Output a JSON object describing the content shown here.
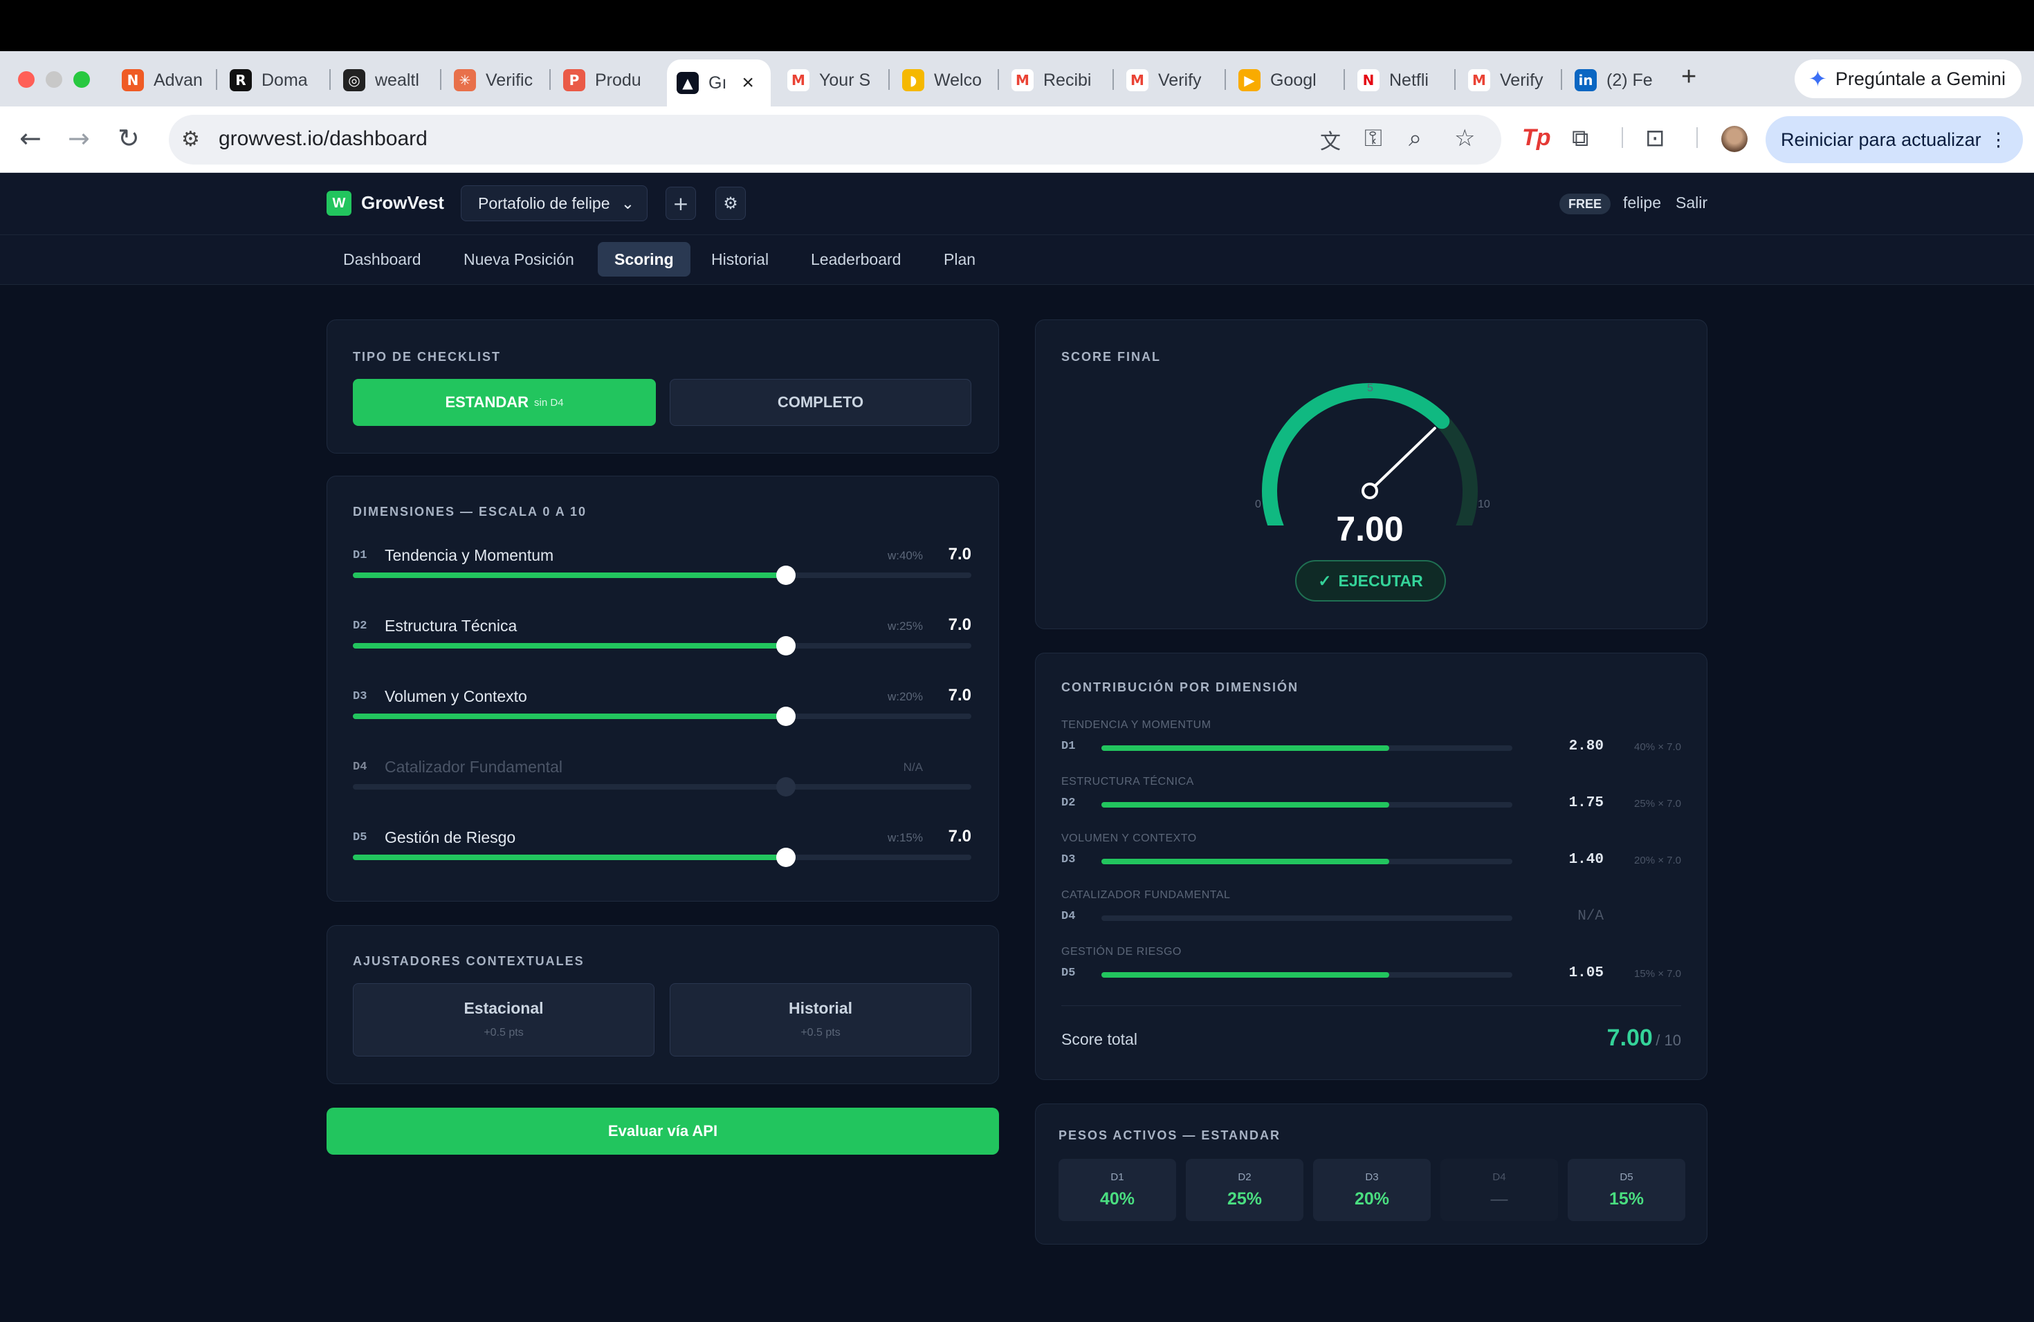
{
  "browser": {
    "tabs": [
      {
        "title": "Advan",
        "icon": "chart-icon",
        "color": "#ef5b25",
        "glyph": "N"
      },
      {
        "title": "Doma",
        "icon": "domain-icon",
        "color": "#111111",
        "glyph": "R"
      },
      {
        "title": "wealtl",
        "icon": "wealth-icon",
        "color": "#222222",
        "glyph": "◎"
      },
      {
        "title": "Verific",
        "icon": "asterisk-icon",
        "color": "#e8704a",
        "glyph": "✳"
      },
      {
        "title": "Produ",
        "icon": "producthunt-icon",
        "color": "#ea5a47",
        "glyph": "P"
      },
      {
        "title": "Gı",
        "icon": "growvest-icon",
        "color": "#0b1120",
        "glyph": "▲"
      },
      {
        "title": "Your S",
        "icon": "gmail-icon",
        "color": "#ffffff",
        "glyph": "M"
      },
      {
        "title": "Welco",
        "icon": "welcome-icon",
        "color": "#f5b800",
        "glyph": "◗"
      },
      {
        "title": "Recibi",
        "icon": "gmail-icon",
        "color": "#ffffff",
        "glyph": "M"
      },
      {
        "title": "Verify",
        "icon": "gmail-icon",
        "color": "#ffffff",
        "glyph": "M"
      },
      {
        "title": "Googl",
        "icon": "meet-icon",
        "color": "#f9ab00",
        "glyph": "▶"
      },
      {
        "title": "Netfli",
        "icon": "netflix-icon",
        "color": "#ffffff",
        "glyph": "N"
      },
      {
        "title": "Verify",
        "icon": "gmail-icon",
        "color": "#ffffff",
        "glyph": "M"
      },
      {
        "title": "(2) Fe",
        "icon": "linkedin-icon",
        "color": "#0a66c2",
        "glyph": "in"
      }
    ],
    "new_tab": "+",
    "gemini_label": "Pregúntale a Gemini",
    "url": "growvest.io/dashboard",
    "update_label": "Reiniciar para actualizar"
  },
  "app": {
    "logo_letter": "W",
    "brand": "GrowVest",
    "portfolio": "Portafolio de felipe",
    "plan_badge": "FREE",
    "user": "felipe",
    "logout": "Salir",
    "nav": [
      "Dashboard",
      "Nueva Posición",
      "Scoring",
      "Historial",
      "Leaderboard",
      "Plan"
    ],
    "active_nav": "Scoring"
  },
  "checklist": {
    "title": "TIPO DE CHECKLIST",
    "standard_label": "ESTANDAR",
    "standard_note": "sin D4",
    "complete_label": "COMPLETO"
  },
  "dimensions": {
    "title": "DIMENSIONES — ESCALA 0 A 10",
    "items": [
      {
        "code": "D1",
        "name": "Tendencia y Momentum",
        "weight": "w:40%",
        "value": "7.0",
        "level": 0.7
      },
      {
        "code": "D2",
        "name": "Estructura Técnica",
        "weight": "w:25%",
        "value": "7.0",
        "level": 0.7
      },
      {
        "code": "D3",
        "name": "Volumen y Contexto",
        "weight": "w:20%",
        "value": "7.0",
        "level": 0.7
      },
      {
        "code": "D4",
        "name": "Catalizador Fundamental",
        "weight": "N/A",
        "value": "",
        "level": 0.7
      },
      {
        "code": "D5",
        "name": "Gestión de Riesgo",
        "weight": "w:15%",
        "value": "7.0",
        "level": 0.7
      }
    ]
  },
  "adjusters": {
    "title": "AJUSTADORES CONTEXTUALES",
    "items": [
      {
        "label": "Estacional",
        "sub": "+0.5 pts"
      },
      {
        "label": "Historial",
        "sub": "+0.5 pts"
      }
    ]
  },
  "api_button": "Evaluar vía API",
  "score": {
    "title": "SCORE FINAL",
    "value": "7.00",
    "level": 0.7,
    "gauge_min": "0",
    "gauge_mid": "5",
    "gauge_max": "10",
    "action": "EJECUTAR"
  },
  "contribution": {
    "title": "CONTRIBUCIÓN POR DIMENSIÓN",
    "items": [
      {
        "label": "TENDENCIA Y MOMENTUM",
        "code": "D1",
        "value": "2.80",
        "formula": "40% × 7.0",
        "level": 0.7
      },
      {
        "label": "ESTRUCTURA TÉCNICA",
        "code": "D2",
        "value": "1.75",
        "formula": "25% × 7.0",
        "level": 0.7
      },
      {
        "label": "VOLUMEN Y CONTEXTO",
        "code": "D3",
        "value": "1.40",
        "formula": "20% × 7.0",
        "level": 0.7
      },
      {
        "label": "CATALIZADOR FUNDAMENTAL",
        "code": "D4",
        "value": "N/A",
        "formula": "",
        "level": 0
      },
      {
        "label": "GESTIÓN DE RIESGO",
        "code": "D5",
        "value": "1.05",
        "formula": "15% × 7.0",
        "level": 0.7
      }
    ],
    "total_label": "Score total",
    "total_value": "7.00",
    "total_suffix": "/ 10"
  },
  "weights": {
    "title": "PESOS ACTIVOS — ESTANDAR",
    "items": [
      {
        "code": "D1",
        "value": "40%"
      },
      {
        "code": "D2",
        "value": "25%"
      },
      {
        "code": "D3",
        "value": "20%"
      },
      {
        "code": "D4",
        "value": "—"
      },
      {
        "code": "D5",
        "value": "15%"
      }
    ]
  },
  "colors": {
    "accent": "#22c55e",
    "accent_text": "#34d399",
    "background": "#0a1120",
    "card": "#111a2b"
  }
}
